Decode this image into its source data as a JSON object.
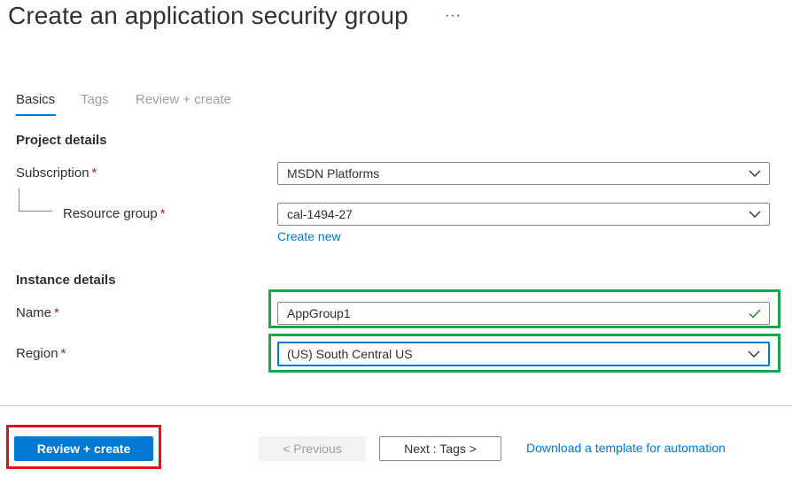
{
  "header": {
    "title": "Create an application security group",
    "more_label": "···"
  },
  "tabs": [
    {
      "label": "Basics",
      "active": true
    },
    {
      "label": "Tags",
      "active": false
    },
    {
      "label": "Review + create",
      "active": false
    }
  ],
  "project_details": {
    "heading": "Project details",
    "subscription": {
      "label": "Subscription",
      "required_mark": "*",
      "value": "MSDN Platforms"
    },
    "resource_group": {
      "label": "Resource group",
      "required_mark": "*",
      "value": "cal-1494-27",
      "create_new_label": "Create new"
    }
  },
  "instance_details": {
    "heading": "Instance details",
    "name": {
      "label": "Name",
      "required_mark": "*",
      "value": "AppGroup1",
      "valid": true
    },
    "region": {
      "label": "Region",
      "required_mark": "*",
      "value": "(US) South Central US"
    }
  },
  "footer": {
    "review_create_label": "Review + create",
    "previous_label": "< Previous",
    "next_label": "Next : Tags >",
    "download_template_label": "Download a template for automation"
  },
  "colors": {
    "accent": "#0078d4",
    "required": "#a4262c",
    "valid_check": "#107c10",
    "highlight_green": "#1ca54a",
    "highlight_red": "#e31313"
  },
  "icons": {
    "dropdown": "chevron-down-icon",
    "valid": "checkmark-icon",
    "more": "more-icon"
  }
}
